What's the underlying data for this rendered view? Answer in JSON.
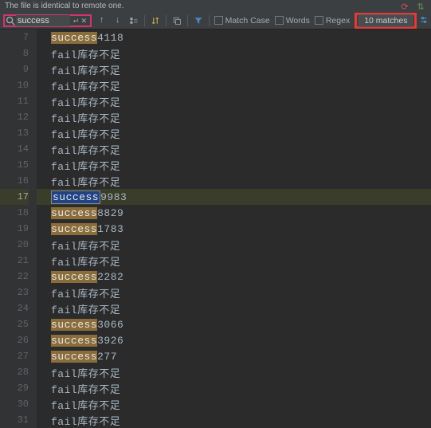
{
  "top_notice": "The file is identical to remote one.",
  "search": {
    "value": "success",
    "placeholder": ""
  },
  "options": {
    "match_case": "Match Case",
    "words": "Words",
    "regex": "Regex"
  },
  "matches_label": "10 matches",
  "current_line": 17,
  "lines": [
    {
      "n": 7,
      "prefix": "success",
      "suffix": "4118",
      "hl": true,
      "sel": false
    },
    {
      "n": 8,
      "prefix": "fail",
      "suffix": "库存不足",
      "hl": false,
      "sel": false
    },
    {
      "n": 9,
      "prefix": "fail",
      "suffix": "库存不足",
      "hl": false,
      "sel": false
    },
    {
      "n": 10,
      "prefix": "fail",
      "suffix": "库存不足",
      "hl": false,
      "sel": false
    },
    {
      "n": 11,
      "prefix": "fail",
      "suffix": "库存不足",
      "hl": false,
      "sel": false
    },
    {
      "n": 12,
      "prefix": "fail",
      "suffix": "库存不足",
      "hl": false,
      "sel": false
    },
    {
      "n": 13,
      "prefix": "fail",
      "suffix": "库存不足",
      "hl": false,
      "sel": false
    },
    {
      "n": 14,
      "prefix": "fail",
      "suffix": "库存不足",
      "hl": false,
      "sel": false
    },
    {
      "n": 15,
      "prefix": "fail",
      "suffix": "库存不足",
      "hl": false,
      "sel": false
    },
    {
      "n": 16,
      "prefix": "fail",
      "suffix": "库存不足",
      "hl": false,
      "sel": false
    },
    {
      "n": 17,
      "prefix": "success",
      "suffix": "9983",
      "hl": false,
      "sel": true
    },
    {
      "n": 18,
      "prefix": "success",
      "suffix": "8829",
      "hl": true,
      "sel": false
    },
    {
      "n": 19,
      "prefix": "success",
      "suffix": "1783",
      "hl": true,
      "sel": false
    },
    {
      "n": 20,
      "prefix": "fail",
      "suffix": "库存不足",
      "hl": false,
      "sel": false
    },
    {
      "n": 21,
      "prefix": "fail",
      "suffix": "库存不足",
      "hl": false,
      "sel": false
    },
    {
      "n": 22,
      "prefix": "success",
      "suffix": "2282",
      "hl": true,
      "sel": false
    },
    {
      "n": 23,
      "prefix": "fail",
      "suffix": "库存不足",
      "hl": false,
      "sel": false
    },
    {
      "n": 24,
      "prefix": "fail",
      "suffix": "库存不足",
      "hl": false,
      "sel": false
    },
    {
      "n": 25,
      "prefix": "success",
      "suffix": "3066",
      "hl": true,
      "sel": false
    },
    {
      "n": 26,
      "prefix": "success",
      "suffix": "3926",
      "hl": true,
      "sel": false
    },
    {
      "n": 27,
      "prefix": "success",
      "suffix": "277",
      "hl": true,
      "sel": false
    },
    {
      "n": 28,
      "prefix": "fail",
      "suffix": "库存不足",
      "hl": false,
      "sel": false
    },
    {
      "n": 29,
      "prefix": "fail",
      "suffix": "库存不足",
      "hl": false,
      "sel": false
    },
    {
      "n": 30,
      "prefix": "fail",
      "suffix": "库存不足",
      "hl": false,
      "sel": false
    },
    {
      "n": 31,
      "prefix": "fail",
      "suffix": "库存不足",
      "hl": false,
      "sel": false
    }
  ]
}
